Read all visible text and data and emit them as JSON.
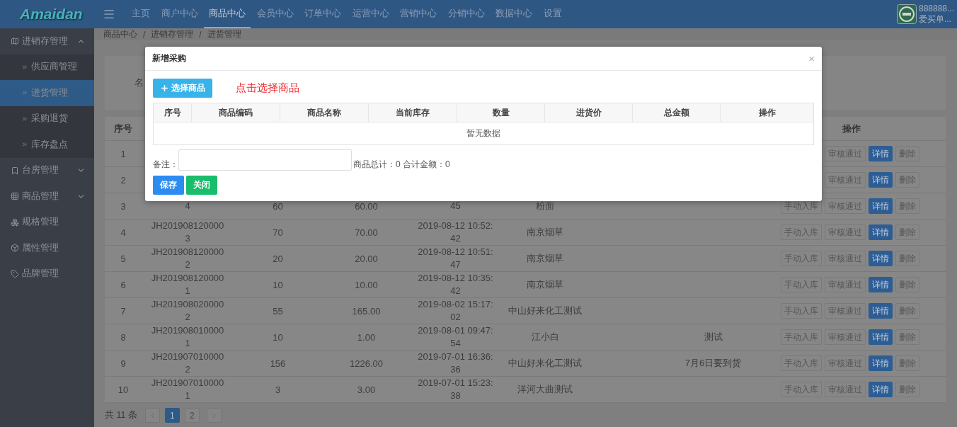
{
  "top_bar": {
    "logo": "Amaidan",
    "menu": [
      {
        "label": "主页",
        "selected": false
      },
      {
        "label": "商户中心",
        "selected": false
      },
      {
        "label": "商品中心",
        "selected": true
      },
      {
        "label": "会员中心",
        "selected": false
      },
      {
        "label": "订单中心",
        "selected": false
      },
      {
        "label": "运营中心",
        "selected": false
      },
      {
        "label": "营销中心",
        "selected": false
      },
      {
        "label": "分销中心",
        "selected": false
      },
      {
        "label": "数据中心",
        "selected": false
      },
      {
        "label": "设置",
        "selected": false
      }
    ],
    "user": {
      "id": "888888...",
      "name": "爱买单..."
    }
  },
  "sidebar": {
    "items": [
      {
        "kind": "group",
        "label": "进销存管理",
        "expanded": true,
        "children": [
          {
            "label": "供应商管理",
            "selected": false
          },
          {
            "label": "进货管理",
            "selected": true
          },
          {
            "label": "采购退货",
            "selected": false
          },
          {
            "label": "库存盘点",
            "selected": false
          }
        ]
      },
      {
        "kind": "group",
        "label": "台房管理",
        "expanded": false
      },
      {
        "kind": "group",
        "label": "商品管理",
        "expanded": false
      },
      {
        "kind": "link",
        "label": "规格管理"
      },
      {
        "kind": "link",
        "label": "属性管理"
      },
      {
        "kind": "link",
        "label": "品牌管理"
      }
    ]
  },
  "breadcrumb": {
    "separator": "/",
    "items": [
      "商品中心",
      "进销存管理",
      "进货管理"
    ]
  },
  "filter": {
    "label": "名"
  },
  "table": {
    "columns": [
      "序号",
      "",
      "",
      "",
      "",
      "",
      "",
      "",
      "操作"
    ],
    "rows": [
      {
        "no": "1",
        "actions": [
          {
            "label": "审核通过",
            "kind": "default",
            "disabled": true
          },
          {
            "label": "详情",
            "kind": "primary",
            "disabled": false
          },
          {
            "label": "删除",
            "kind": "default",
            "disabled": true
          }
        ]
      },
      {
        "no": "2",
        "actions": [
          {
            "label": "审核通过",
            "kind": "default",
            "disabled": true
          },
          {
            "label": "详情",
            "kind": "primary",
            "disabled": false
          },
          {
            "label": "删除",
            "kind": "default",
            "disabled": true
          }
        ]
      },
      {
        "no": "3",
        "code": "4",
        "qty": "60",
        "price": "60.00",
        "time": "45",
        "name": "粉面",
        "actions": [
          {
            "label": "手动入库",
            "kind": "default",
            "disabled": true
          },
          {
            "label": "审核通过",
            "kind": "default",
            "disabled": true
          },
          {
            "label": "详情",
            "kind": "primary",
            "disabled": false
          },
          {
            "label": "删除",
            "kind": "default",
            "disabled": true
          }
        ]
      },
      {
        "no": "4",
        "code": "JH2019081200003",
        "qty": "70",
        "price": "70.00",
        "time": "2019-08-12 10:52:42",
        "name": "南京烟草",
        "actions": [
          {
            "label": "手动入库",
            "kind": "default",
            "disabled": true
          },
          {
            "label": "审核通过",
            "kind": "default",
            "disabled": true
          },
          {
            "label": "详情",
            "kind": "primary",
            "disabled": false
          },
          {
            "label": "删除",
            "kind": "default",
            "disabled": true
          }
        ]
      },
      {
        "no": "5",
        "code": "JH2019081200002",
        "qty": "20",
        "price": "20.00",
        "time": "2019-08-12 10:51:47",
        "name": "南京烟草",
        "actions": [
          {
            "label": "手动入库",
            "kind": "default",
            "disabled": true
          },
          {
            "label": "审核通过",
            "kind": "default",
            "disabled": true
          },
          {
            "label": "详情",
            "kind": "primary",
            "disabled": false
          },
          {
            "label": "删除",
            "kind": "default",
            "disabled": true
          }
        ]
      },
      {
        "no": "6",
        "code": "JH2019081200001",
        "qty": "10",
        "price": "10.00",
        "time": "2019-08-12 10:35:42",
        "name": "南京烟草",
        "actions": [
          {
            "label": "手动入库",
            "kind": "default",
            "disabled": true
          },
          {
            "label": "审核通过",
            "kind": "default",
            "disabled": true
          },
          {
            "label": "详情",
            "kind": "primary",
            "disabled": false
          },
          {
            "label": "删除",
            "kind": "default",
            "disabled": true
          }
        ]
      },
      {
        "no": "7",
        "code": "JH2019080200002",
        "qty": "55",
        "price": "165.00",
        "time": "2019-08-02 15:17:02",
        "name": "中山好来化工测试",
        "actions": [
          {
            "label": "手动入库",
            "kind": "default",
            "disabled": true
          },
          {
            "label": "审核通过",
            "kind": "default",
            "disabled": true
          },
          {
            "label": "详情",
            "kind": "primary",
            "disabled": false
          },
          {
            "label": "删除",
            "kind": "default",
            "disabled": true
          }
        ]
      },
      {
        "no": "8",
        "code": "JH2019080100001",
        "qty": "10",
        "price": "1.00",
        "time": "2019-08-01 09:47:54",
        "name": "江小白",
        "note": "测试",
        "actions": [
          {
            "label": "手动入库",
            "kind": "default",
            "disabled": true
          },
          {
            "label": "审核通过",
            "kind": "default",
            "disabled": true
          },
          {
            "label": "详情",
            "kind": "primary",
            "disabled": false
          },
          {
            "label": "删除",
            "kind": "default",
            "disabled": true
          }
        ]
      },
      {
        "no": "9",
        "code": "JH2019070100002",
        "qty": "156",
        "price": "1226.00",
        "time": "2019-07-01 16:36:36",
        "name": "中山好来化工测试",
        "note": "7月6日要到货",
        "actions": [
          {
            "label": "手动入库",
            "kind": "default",
            "disabled": true
          },
          {
            "label": "审核通过",
            "kind": "default",
            "disabled": true
          },
          {
            "label": "详情",
            "kind": "primary",
            "disabled": false
          },
          {
            "label": "删除",
            "kind": "default",
            "disabled": true
          }
        ]
      },
      {
        "no": "10",
        "code": "JH2019070100001",
        "qty": "3",
        "price": "3.00",
        "time": "2019-07-01 15:23:38",
        "name": "洋河大曲测试",
        "actions": [
          {
            "label": "手动入库",
            "kind": "default",
            "disabled": true
          },
          {
            "label": "审核通过",
            "kind": "default",
            "disabled": true
          },
          {
            "label": "详情",
            "kind": "primary",
            "disabled": false
          },
          {
            "label": "删除",
            "kind": "default",
            "disabled": true
          }
        ]
      }
    ]
  },
  "pagination": {
    "total": "共 11 条",
    "pages": [
      {
        "label": "1",
        "selected": true
      },
      {
        "label": "2",
        "selected": false
      }
    ]
  },
  "modal": {
    "title": "新增采购",
    "close": "×",
    "select_button": "选择商品",
    "hint": "点击选择商品",
    "columns": [
      "序号",
      "商品编码",
      "商品名称",
      "当前库存",
      "数量",
      "进货价",
      "总金额",
      "操作"
    ],
    "empty": "暂无数据",
    "remark_label": "备注：",
    "summary": "商品总计：0 合计金额：0",
    "buttons": [
      {
        "label": "保存",
        "kind": "primary"
      },
      {
        "label": "关闭",
        "kind": "success"
      }
    ]
  }
}
